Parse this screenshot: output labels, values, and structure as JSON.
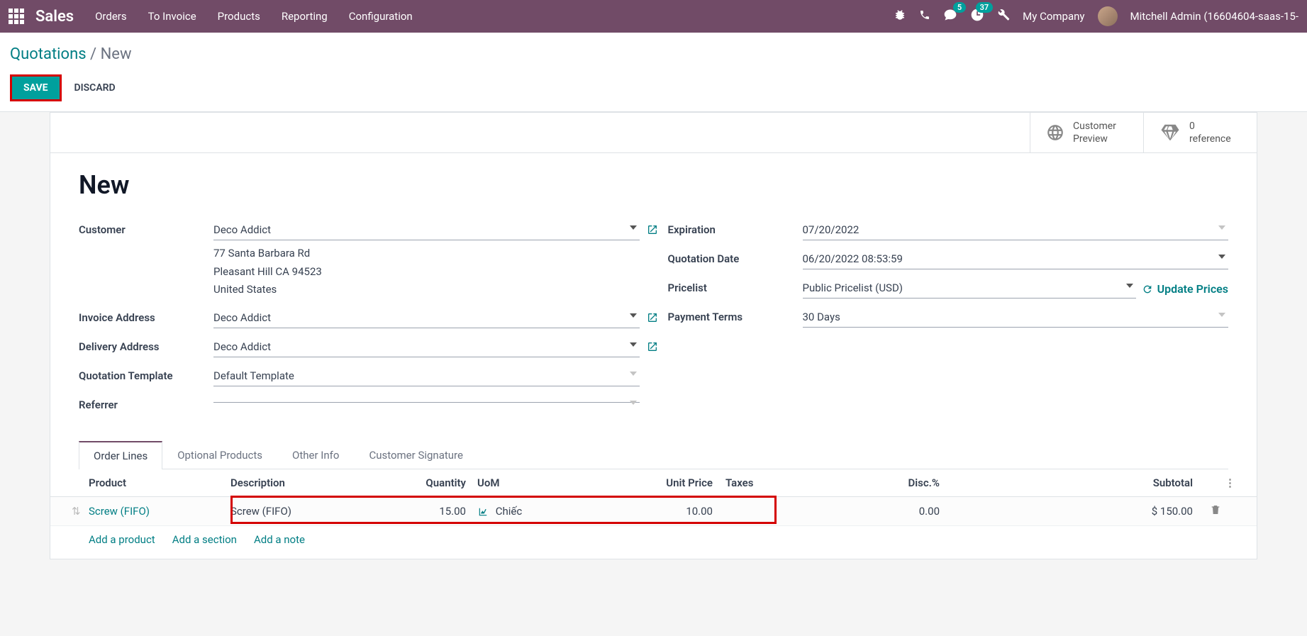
{
  "topbar": {
    "brand": "Sales",
    "menu": [
      "Orders",
      "To Invoice",
      "Products",
      "Reporting",
      "Configuration"
    ],
    "messages_badge": "5",
    "activities_badge": "37",
    "company": "My Company",
    "user": "Mitchell Admin (16604604-saas-15-"
  },
  "breadcrumb": {
    "root": "Quotations",
    "current": "New"
  },
  "actions": {
    "save": "SAVE",
    "discard": "DISCARD"
  },
  "statbuttons": {
    "preview": {
      "l1": "Customer",
      "l2": "Preview"
    },
    "ref": {
      "l1": "0",
      "l2": "reference"
    }
  },
  "title": "New",
  "left": {
    "customer_label": "Customer",
    "customer_value": "Deco Addict",
    "addr_line1": "77 Santa Barbara Rd",
    "addr_line2": "Pleasant Hill CA 94523",
    "addr_line3": "United States",
    "invoice_addr_label": "Invoice Address",
    "invoice_addr_value": "Deco Addict",
    "delivery_addr_label": "Delivery Address",
    "delivery_addr_value": "Deco Addict",
    "template_label": "Quotation Template",
    "template_value": "Default Template",
    "referrer_label": "Referrer",
    "referrer_value": ""
  },
  "right": {
    "expiration_label": "Expiration",
    "expiration_value": "07/20/2022",
    "quote_date_label": "Quotation Date",
    "quote_date_value": "06/20/2022 08:53:59",
    "pricelist_label": "Pricelist",
    "pricelist_value": "Public Pricelist (USD)",
    "update_prices": "Update Prices",
    "payment_terms_label": "Payment Terms",
    "payment_terms_value": "30 Days"
  },
  "tabs": [
    "Order Lines",
    "Optional Products",
    "Other Info",
    "Customer Signature"
  ],
  "columns": {
    "product": "Product",
    "desc": "Description",
    "qty": "Quantity",
    "uom": "UoM",
    "price": "Unit Price",
    "tax": "Taxes",
    "disc": "Disc.%",
    "sub": "Subtotal"
  },
  "line": {
    "product": "Screw (FIFO)",
    "desc": "Screw (FIFO)",
    "qty": "15.00",
    "uom": "Chiếc",
    "price": "10.00",
    "tax": "",
    "disc": "0.00",
    "sub": "$ 150.00"
  },
  "add": {
    "product": "Add a product",
    "section": "Add a section",
    "note": "Add a note"
  }
}
